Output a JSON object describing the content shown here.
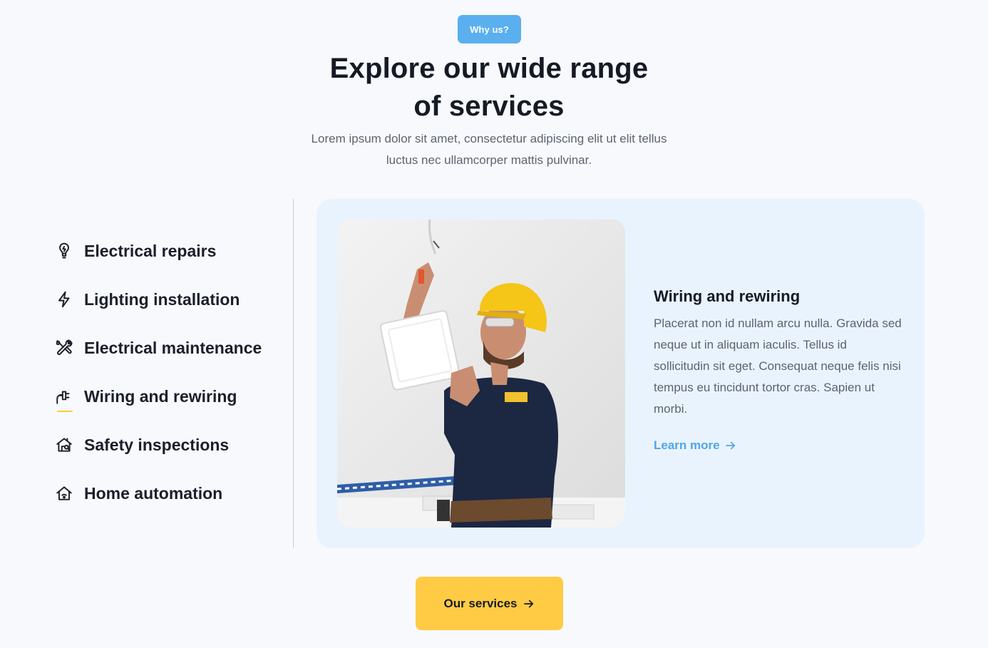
{
  "header": {
    "badge": "Why us?",
    "title": "Explore our wide range of services",
    "subtitle": "Lorem ipsum dolor sit amet, consectetur adipiscing elit ut elit tellus luctus nec ullamcorper mattis pulvinar."
  },
  "services": [
    {
      "label": "Electrical repairs",
      "icon": "lightbulb-icon"
    },
    {
      "label": "Lighting installation",
      "icon": "lightning-bolt-icon"
    },
    {
      "label": "Electrical maintenance",
      "icon": "tools-icon"
    },
    {
      "label": "Wiring and rewiring",
      "icon": "plug-icon",
      "active": true
    },
    {
      "label": "Safety inspections",
      "icon": "house-inspection-icon"
    },
    {
      "label": "Home automation",
      "icon": "smart-home-icon"
    }
  ],
  "detail": {
    "title": "Wiring and rewiring",
    "text": "Placerat non id nullam arcu nulla. Gravida sed neque ut in aliquam iaculis. Tellus id sollicitudin sit eget. Consequat neque felis nisi tempus eu tincidunt tortor cras. Sapien ut morbi.",
    "link_label": "Learn more"
  },
  "cta": {
    "label": "Our services"
  },
  "colors": {
    "accent_blue": "#5aafef",
    "accent_yellow": "#ffcb45",
    "card_bg": "#e9f3fd",
    "page_bg": "#f7f9fc"
  }
}
